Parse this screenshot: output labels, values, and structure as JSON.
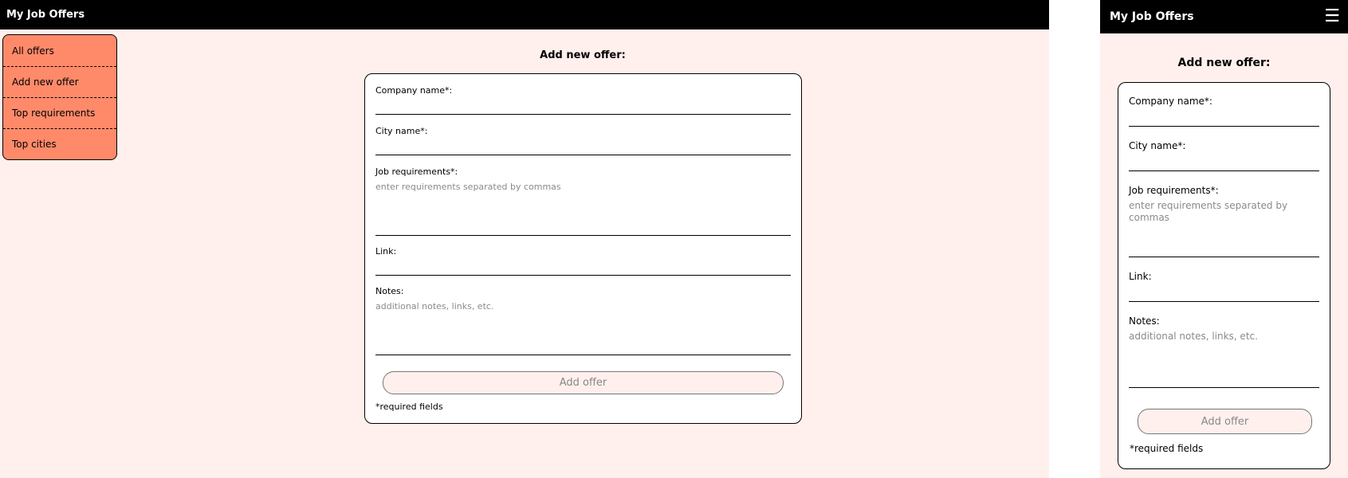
{
  "app": {
    "title": "My Job Offers"
  },
  "nav": {
    "items": [
      {
        "label": "All offers"
      },
      {
        "label": "Add new offer"
      },
      {
        "label": "Top requirements"
      },
      {
        "label": "Top cities"
      }
    ]
  },
  "form": {
    "title": "Add new offer:",
    "fields": {
      "company": {
        "label": "Company name*:",
        "value": "",
        "placeholder": ""
      },
      "city": {
        "label": "City name*:",
        "value": "",
        "placeholder": ""
      },
      "requirements": {
        "label": "Job requirements*:",
        "placeholder": "enter requirements separated by commas"
      },
      "link": {
        "label": "Link:",
        "value": "",
        "placeholder": ""
      },
      "notes": {
        "label": "Notes:",
        "placeholder": "additional notes, links, etc."
      }
    },
    "submit_label": "Add offer",
    "required_note": "*required fields"
  },
  "mobile": {
    "menu_icon": "hamburger-icon",
    "menu_glyph": "☰"
  },
  "colors": {
    "topbar": "#000000",
    "background": "#fff0ed",
    "nav_bg": "#ff8a6a",
    "card_bg": "#ffffff",
    "button_bg": "#fff0ed"
  }
}
